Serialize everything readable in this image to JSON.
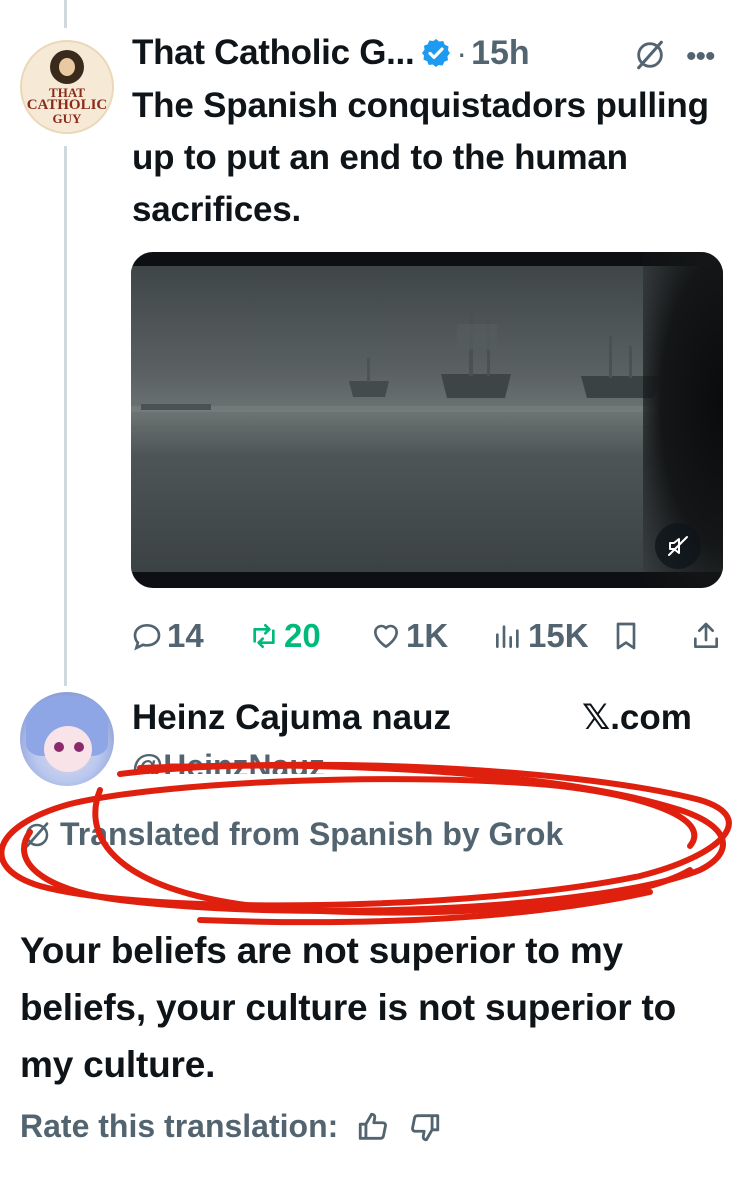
{
  "tweet": {
    "author_name": "That Catholic G...",
    "avatar_text": [
      "THAT",
      "CATHOLIC",
      "GUY"
    ],
    "separator": "·",
    "time": "15h",
    "text": "The Spanish conquistadors pulling up to put an end to the human sacrifices.",
    "stats": {
      "replies": "14",
      "reposts": "20",
      "likes": "1K",
      "views": "15K"
    }
  },
  "reply": {
    "name": "Heinz Cajuma nauz",
    "source": "𝕏.com",
    "handle": "@HeinzNauz",
    "translation_notice": "Translated from Spanish by Grok",
    "text": "Your beliefs are not superior to my beliefs, your culture is not superior to my culture.",
    "rate_label": "Rate this translation:"
  },
  "colors": {
    "text": "#0f1419",
    "secondary": "#536471",
    "repost_green": "#00ba7c",
    "verified_blue": "#1d9bf0",
    "annotation_red": "#e0200f"
  },
  "icons": [
    "verified-badge-icon",
    "grok-icon",
    "more-icon",
    "mute-icon",
    "reply-icon",
    "repost-icon",
    "like-icon",
    "views-icon",
    "bookmark-icon",
    "share-icon",
    "thumbs-up-icon",
    "thumbs-down-icon"
  ]
}
